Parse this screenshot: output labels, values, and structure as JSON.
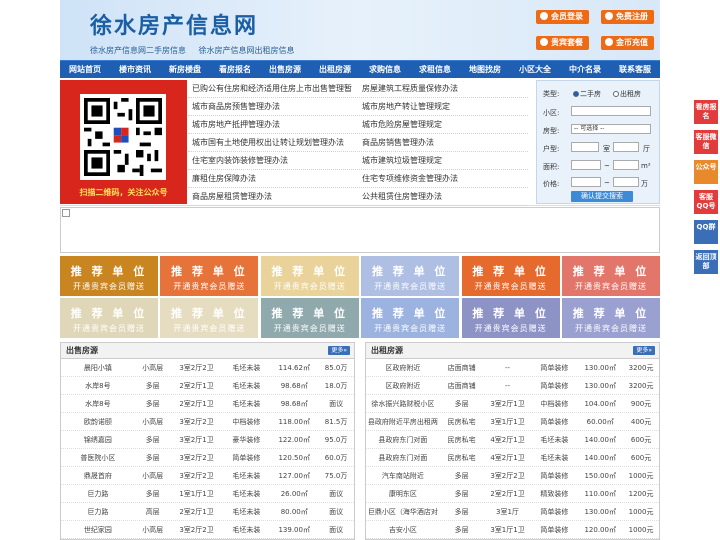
{
  "header": {
    "logo": "徐水房产信息网",
    "sublinks": [
      "徐水房产信息网二手房信息",
      "徐水房产信息网出租房信息"
    ],
    "buttons": [
      "会员登录",
      "免费注册",
      "贵宾套餐",
      "金币充值"
    ]
  },
  "nav": [
    "网站首页",
    "楼市资讯",
    "新房楼盘",
    "看房报名",
    "出售房源",
    "出租房源",
    "求购信息",
    "求租信息",
    "地图找房",
    "小区大全",
    "中介名录",
    "联系客服"
  ],
  "qr": {
    "caption": "扫描二维码，关注公众号"
  },
  "links": [
    [
      "已购公有住房和经济适用住房上市出售管理暂",
      "房屋建筑工程质量保修办法"
    ],
    [
      "城市商品房预售管理办法",
      "城市房地产转让管理规定"
    ],
    [
      "城市房地产抵押管理办法",
      "城市危险房屋管理规定"
    ],
    [
      "城市国有土地使用权出让转让规划管理办法",
      "商品房销售管理办法"
    ],
    [
      "住宅室内装饰装修管理办法",
      "城市建筑垃圾管理规定"
    ],
    [
      "廉租住房保障办法",
      "住宅专项维修资金管理办法"
    ],
    [
      "商品房屋租赁管理办法",
      "公共租赁住房管理办法"
    ]
  ],
  "search": {
    "type_label": "类型:",
    "opt1": "二手房",
    "opt2": "出租房",
    "community_label": "小区:",
    "house_label": "房型:",
    "house_select": "-- 可选择 --",
    "layout_label": "户型:",
    "room": "室",
    "hall": "厅",
    "area_label": "面积:",
    "area_unit": "m²",
    "price_label": "价格:",
    "price_unit": "万",
    "submit": "确认提交搜索"
  },
  "ads": [
    {
      "t1": "推 荐 单 位",
      "t2": "开通贵宾会员赠送",
      "color": "#c9851f"
    },
    {
      "t1": "推 荐 单 位",
      "t2": "开通贵宾会员赠送",
      "color": "#e5733a"
    },
    {
      "t1": "推 荐 单 位",
      "t2": "开通贵宾会员赠送",
      "color": "#e9d39a"
    },
    {
      "t1": "推 荐 单 位",
      "t2": "开通贵宾会员赠送",
      "color": "#aebfe3"
    },
    {
      "t1": "推 荐 单 位",
      "t2": "开通贵宾会员赠送",
      "color": "#e6692d"
    },
    {
      "t1": "推 荐 单 位",
      "t2": "开通贵宾会员赠送",
      "color": "#e2766a"
    },
    {
      "t1": "推 荐 单 位",
      "t2": "开通贵宾会员赠送",
      "color": "#e0d7b8"
    },
    {
      "t1": "推 荐 单 位",
      "t2": "开通贵宾会员赠送",
      "color": "#e6ddc0"
    },
    {
      "t1": "推 荐 单 位",
      "t2": "开通贵宾会员赠送",
      "color": "#8fa9ad"
    },
    {
      "t1": "推 荐 单 位",
      "t2": "开通贵宾会员赠送",
      "color": "#9cb3e0"
    },
    {
      "t1": "推 荐 单 位",
      "t2": "开通贵宾会员赠送",
      "color": "#8e93c6"
    },
    {
      "t1": "推 荐 单 位",
      "t2": "开通贵宾会员赠送",
      "color": "#9aa0cf"
    }
  ],
  "sale": {
    "title": "出售房源",
    "more": "更多»",
    "rows": [
      [
        "晨阳小镇",
        "小高层",
        "3室2厅2卫",
        "毛坯未装",
        "114.62㎡",
        "85.0万"
      ],
      [
        "水岸8号",
        "多层",
        "2室2厅1卫",
        "毛坯未装",
        "98.68㎡",
        "18.0万"
      ],
      [
        "水岸8号",
        "多层",
        "2室2厅1卫",
        "毛坯未装",
        "98.68㎡",
        "面议"
      ],
      [
        "欧韵诺颐",
        "小高层",
        "3室2厅2卫",
        "中档装修",
        "118.00㎡",
        "81.5万"
      ],
      [
        "锦绣嘉园",
        "多层",
        "3室2厅1卫",
        "豪华装修",
        "122.00㎡",
        "95.0万"
      ],
      [
        "普医院小区",
        "多层",
        "3室2厅2卫",
        "简单装修",
        "120.50㎡",
        "60.0万"
      ],
      [
        "鼎晟首府",
        "小高层",
        "3室2厅2卫",
        "毛坯未装",
        "127.00㎡",
        "75.0万"
      ],
      [
        "巨力路",
        "多层",
        "1室1厅1卫",
        "毛坯未装",
        "26.00㎡",
        "面议"
      ],
      [
        "巨力路",
        "高层",
        "2室2厅1卫",
        "毛坯未装",
        "80.00㎡",
        "面议"
      ],
      [
        "世纪家园",
        "小高层",
        "3室2厅2卫",
        "毛坯未装",
        "139.00㎡",
        "面议"
      ]
    ]
  },
  "rent": {
    "title": "出租房源",
    "more": "更多»",
    "rows": [
      [
        "区政府附近",
        "店面商铺",
        "--",
        "简单装修",
        "130.00㎡",
        "3200元"
      ],
      [
        "区政府附近",
        "店面商铺",
        "--",
        "简单装修",
        "130.00㎡",
        "3200元"
      ],
      [
        "徐水振兴路财税小区",
        "多层",
        "3室2厅1卫",
        "中档装修",
        "104.00㎡",
        "900元"
      ],
      [
        "县政府附近平房出租两",
        "民房私宅",
        "3室1厅1卫",
        "简单装修",
        "60.00㎡",
        "400元"
      ],
      [
        "县政府东门对面",
        "民房私宅",
        "4室2厅1卫",
        "毛坯未装",
        "140.00㎡",
        "600元"
      ],
      [
        "县政府东门对面",
        "民房私宅",
        "4室2厅1卫",
        "毛坯未装",
        "140.00㎡",
        "600元"
      ],
      [
        "汽车南站附近",
        "多层",
        "3室2厅2卫",
        "简单装修",
        "150.00㎡",
        "1000元"
      ],
      [
        "康明东区",
        "多层",
        "2室2厅1卫",
        "精致装修",
        "110.00㎡",
        "1200元"
      ],
      [
        "巨鼎小区（海华酒店对",
        "多层",
        "3室1厅",
        "简单装修",
        "130.00㎡",
        "1000元"
      ],
      [
        "吉安小区",
        "多层",
        "3室1厅1卫",
        "简单装修",
        "120.00㎡",
        "1000元"
      ]
    ]
  },
  "sidebar": [
    "看房报名",
    "客服微信",
    "公众号",
    "客服QQ号",
    "QQ群",
    "返回顶部"
  ],
  "colors": {
    "nav": "#1e5fb4",
    "accent": "#ef6a15",
    "sidebar": "#e23b3b"
  }
}
